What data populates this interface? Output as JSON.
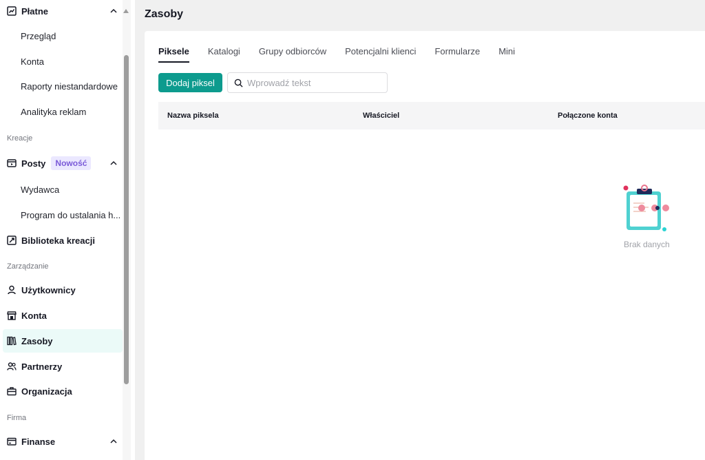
{
  "sidebar": {
    "platne": {
      "label": "Płatne"
    },
    "platne_items": [
      {
        "label": "Przegląd"
      },
      {
        "label": "Konta"
      },
      {
        "label": "Raporty niestandardowe"
      },
      {
        "label": "Analityka reklam"
      }
    ],
    "section_kreacje": "Kreacje",
    "posty": {
      "label": "Posty",
      "badge": "Nowość"
    },
    "posty_items": [
      {
        "label": "Wydawca"
      },
      {
        "label": "Program do ustalania h..."
      }
    ],
    "biblioteka": {
      "label": "Biblioteka kreacji"
    },
    "section_zarzadzanie": "Zarządzanie",
    "uzytkownicy": {
      "label": "Użytkownicy"
    },
    "konta": {
      "label": "Konta"
    },
    "zasoby": {
      "label": "Zasoby"
    },
    "partnerzy": {
      "label": "Partnerzy"
    },
    "organizacja": {
      "label": "Organizacja"
    },
    "section_firma": "Firma",
    "finanse": {
      "label": "Finanse"
    }
  },
  "header": {
    "title": "Zasoby"
  },
  "tabs": [
    {
      "label": "Piksele",
      "active": true
    },
    {
      "label": "Katalogi"
    },
    {
      "label": "Grupy odbiorców"
    },
    {
      "label": "Potencjalni klienci"
    },
    {
      "label": "Formularze"
    },
    {
      "label": "Mini"
    }
  ],
  "toolbar": {
    "add_label": "Dodaj piksel",
    "search_placeholder": "Wprowadź tekst",
    "search_value": ""
  },
  "table": {
    "columns": [
      "Nazwa piksela",
      "Właściciel",
      "Połączone konta"
    ],
    "rows": []
  },
  "empty_state": {
    "text": "Brak danych"
  },
  "colors": {
    "accent": "#0d9b8e",
    "active_row_bg": "#ebfaf8",
    "badge_bg": "#ebe8ff",
    "badge_text": "#7a5ad8"
  }
}
